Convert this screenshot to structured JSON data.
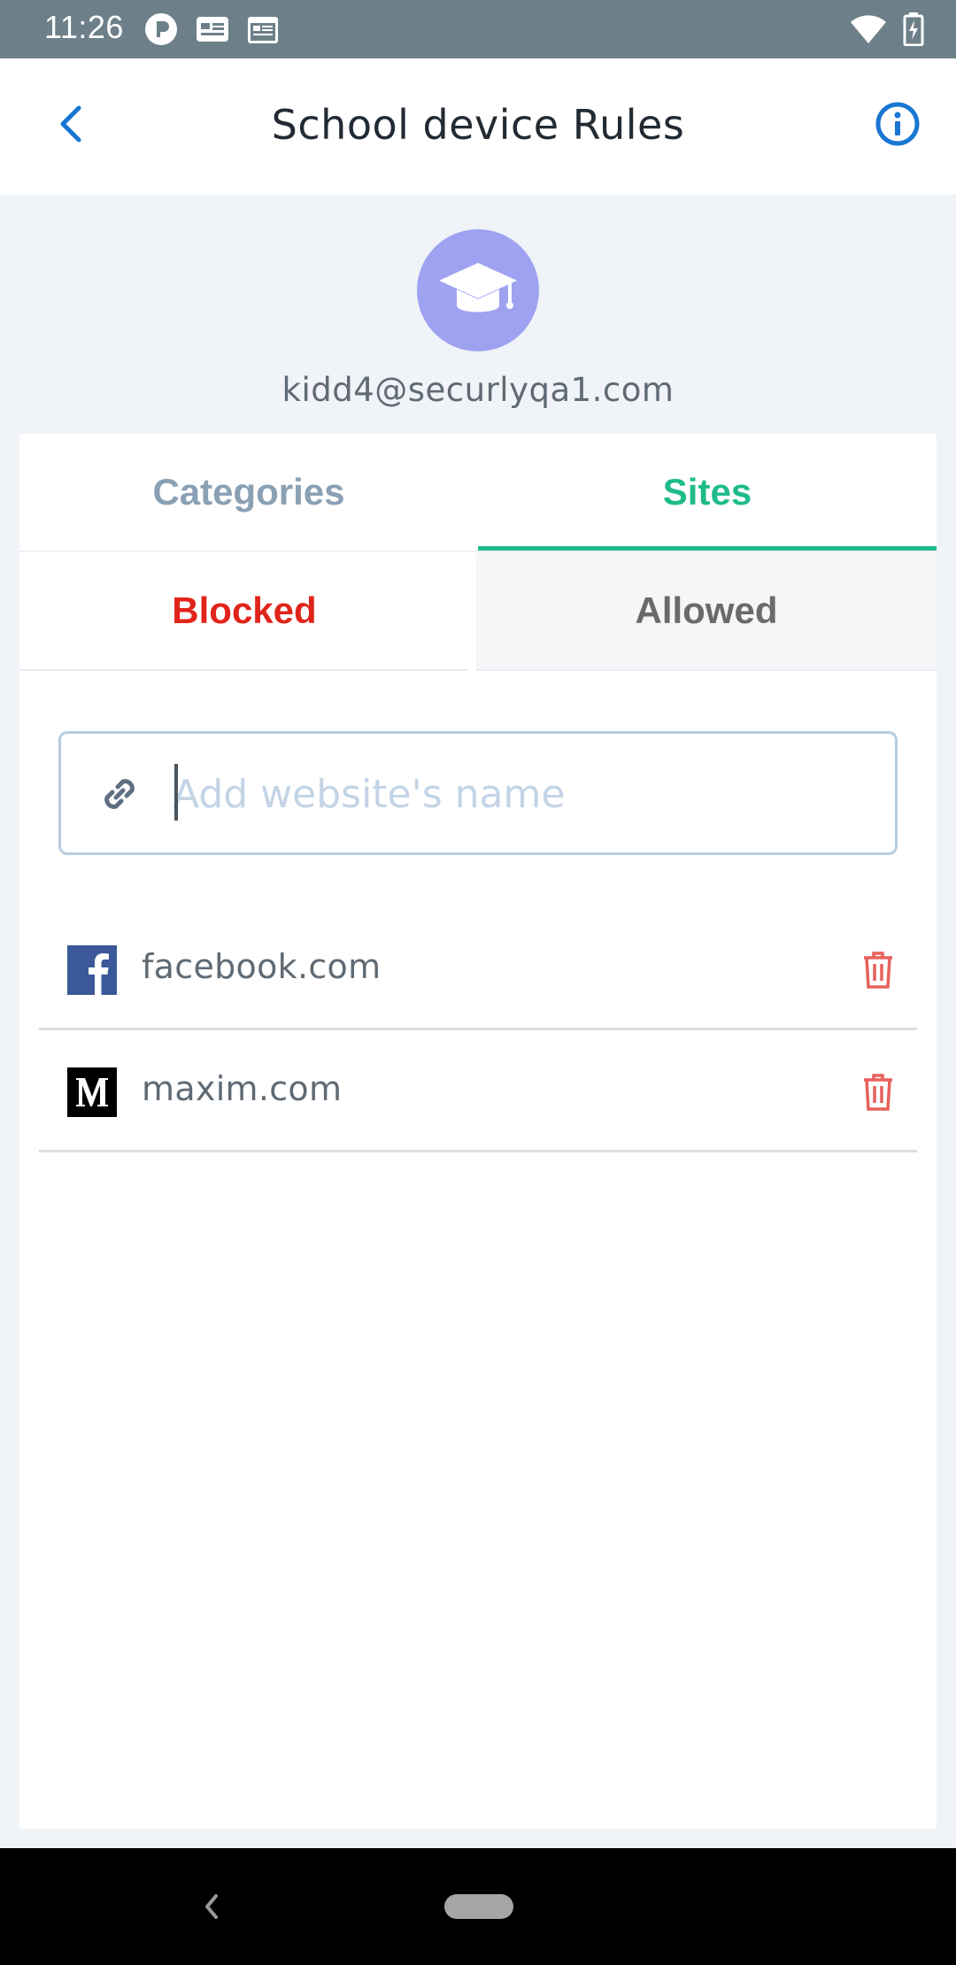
{
  "status_bar": {
    "time": "11:26",
    "left_icons": [
      "app-notification-icon",
      "id-card-icon",
      "calendar-icon"
    ],
    "right_icons": [
      "wifi-icon",
      "battery-charging-icon"
    ]
  },
  "app_bar": {
    "title": "School device Rules",
    "back_icon": "chevron-left-icon",
    "info_icon": "info-icon"
  },
  "profile": {
    "avatar_icon": "graduation-cap-icon",
    "email": "kidd4@securlyqa1.com"
  },
  "tabs": {
    "items": [
      {
        "label": "Categories",
        "active": false
      },
      {
        "label": "Sites",
        "active": true
      }
    ]
  },
  "sub_tabs": {
    "items": [
      {
        "label": "Blocked",
        "active": true
      },
      {
        "label": "Allowed",
        "active": false
      }
    ]
  },
  "search": {
    "placeholder": "Add website's name",
    "value": "",
    "icon": "link-icon"
  },
  "sites": [
    {
      "name": "facebook.com",
      "favicon": "facebook-logo-icon",
      "delete_icon": "trash-icon"
    },
    {
      "name": "maxim.com",
      "favicon": "maxim-logo-icon",
      "delete_icon": "trash-icon"
    }
  ],
  "colors": {
    "accent_green": "#1fbb8b",
    "blocked_red": "#e0241a",
    "link_blue": "#1976d2",
    "delete_red": "#e8615d",
    "avatar_purple": "#9ea2f1"
  }
}
